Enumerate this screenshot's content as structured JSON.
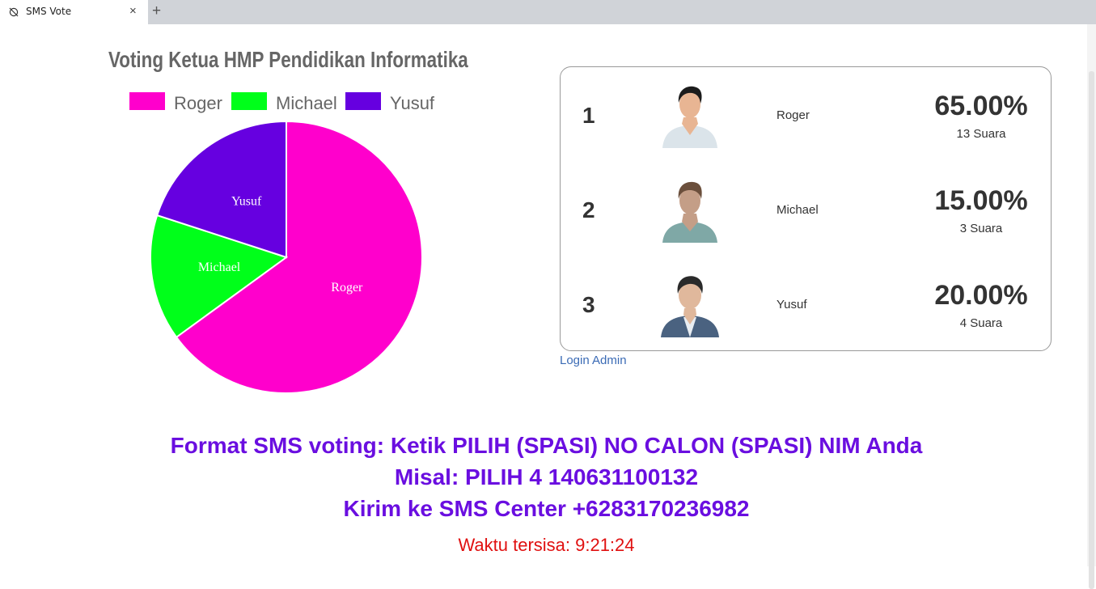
{
  "browser": {
    "tab_title": "SMS Vote",
    "close_glyph": "×",
    "new_tab_glyph": "+"
  },
  "chart_data": {
    "type": "pie",
    "title": "Voting Ketua HMP Pendidikan Informatika",
    "categories": [
      "Roger",
      "Michael",
      "Yusuf"
    ],
    "values": [
      65,
      15,
      20
    ],
    "colors": [
      "#ff00cc",
      "#00ff1a",
      "#6600e0"
    ],
    "legend": "top"
  },
  "candidates": [
    {
      "rank": "1",
      "name": "Roger",
      "percent": "65.00%",
      "votes": "13 Suara",
      "avatar": "man-white-shirt-avatar"
    },
    {
      "rank": "2",
      "name": "Michael",
      "percent": "15.00%",
      "votes": "3 Suara",
      "avatar": "man-teal-shirt-avatar"
    },
    {
      "rank": "3",
      "name": "Yusuf",
      "percent": "20.00%",
      "votes": "4 Suara",
      "avatar": "man-suit-avatar"
    }
  ],
  "login_link": "Login Admin",
  "instructions": {
    "line1": "Format SMS voting: Ketik PILIH (SPASI) NO CALON (SPASI) NIM Anda",
    "line2": "Misal: PILIH 4 140631100132",
    "line3": "Kirim ke SMS Center +6283170236982"
  },
  "timer": "Waktu tersisa: 9:21:24"
}
